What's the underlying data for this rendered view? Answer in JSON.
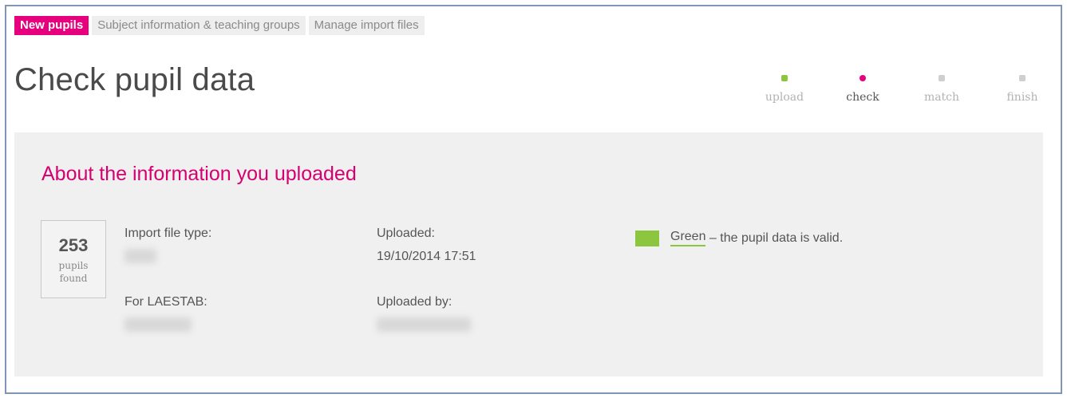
{
  "tabs": [
    {
      "label": "New pupils",
      "active": true
    },
    {
      "label": "Subject information & teaching groups",
      "active": false
    },
    {
      "label": "Manage import files",
      "active": false
    }
  ],
  "page": {
    "title": "Check pupil data"
  },
  "steps": [
    {
      "label": "upload",
      "state": "done"
    },
    {
      "label": "check",
      "state": "current"
    },
    {
      "label": "match",
      "state": "pending"
    },
    {
      "label": "finish",
      "state": "pending"
    }
  ],
  "panel": {
    "title": "About the information you uploaded",
    "count": {
      "value": "253",
      "unit": "pupils found"
    },
    "fields": {
      "import_file_type": {
        "label": "Import file type:"
      },
      "for_laestab": {
        "label": "For LAESTAB:"
      },
      "uploaded": {
        "label": "Uploaded:",
        "value": "19/10/2014 17:51"
      },
      "uploaded_by": {
        "label": "Uploaded by:"
      }
    },
    "legend": {
      "color_word": "Green",
      "text": " – the pupil data is valid."
    }
  },
  "colors": {
    "brand": "#e6007e",
    "valid_green": "#8cc63f",
    "panel_bg": "#f0f0f0"
  }
}
